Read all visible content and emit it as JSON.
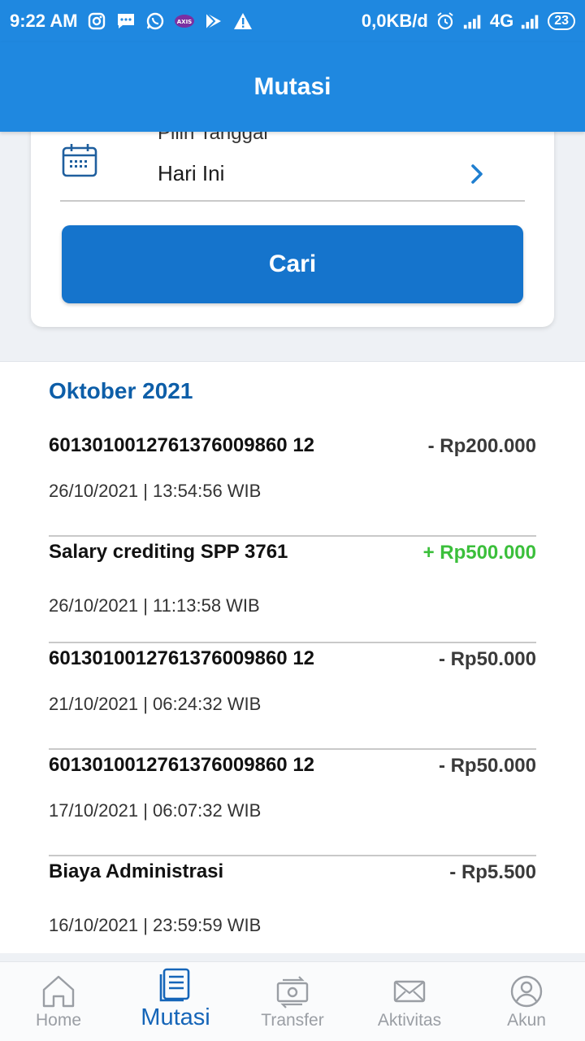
{
  "status_bar": {
    "time": "9:22 AM",
    "net_speed": "0,0KB/d",
    "network": "4G",
    "battery": "23",
    "left_icons": [
      "instagram-icon",
      "message-icon",
      "whatsapp-icon",
      "axis-icon",
      "play-store-icon",
      "warning-icon"
    ],
    "right_icons": [
      "alarm-icon",
      "signal-icon",
      "signal-icon"
    ],
    "background": "#1f88e0"
  },
  "header": {
    "title": "Mutasi"
  },
  "filter": {
    "date_label": "Pilih Tanggal",
    "date_value": "Hari Ini",
    "search_button": "Cari",
    "accent": "#1574cc"
  },
  "transactions": {
    "month": "Oktober 2021",
    "items": [
      {
        "title": "6013010012761376009860 12",
        "amount": "- Rp200.000",
        "date": "26/10/2021 | 13:54:56 WIB",
        "type": "debit"
      },
      {
        "title": "Salary crediting SPP 3761",
        "amount": "+ Rp500.000",
        "date": "26/10/2021 | 11:13:58 WIB",
        "type": "credit"
      },
      {
        "title": "6013010012761376009860 12",
        "amount": "- Rp50.000",
        "date": "21/10/2021 | 06:24:32 WIB",
        "type": "debit"
      },
      {
        "title": "6013010012761376009860 12",
        "amount": "- Rp50.000",
        "date": "17/10/2021 | 06:07:32 WIB",
        "type": "debit"
      },
      {
        "title": "Biaya Administrasi",
        "amount": "- Rp5.500",
        "date": "16/10/2021 | 23:59:59 WIB",
        "type": "debit"
      }
    ],
    "credit_color": "#3bbf3b"
  },
  "bottom_nav": {
    "items": [
      {
        "label": "Home",
        "icon": "home-icon",
        "active": false
      },
      {
        "label": "Mutasi",
        "icon": "document-icon",
        "active": true
      },
      {
        "label": "Transfer",
        "icon": "money-transfer-icon",
        "active": false
      },
      {
        "label": "Aktivitas",
        "icon": "mail-icon",
        "active": false
      },
      {
        "label": "Akun",
        "icon": "user-icon",
        "active": false
      }
    ],
    "active_color": "#1565b8"
  }
}
